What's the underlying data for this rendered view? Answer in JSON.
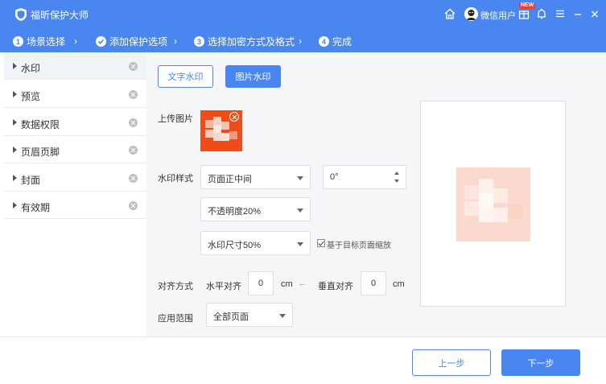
{
  "app": {
    "title": "福昕保护大师",
    "logo_icon": "shield-icon",
    "accent_color": "#4a86f0"
  },
  "titlebar": {
    "user_name": "微信用户",
    "new_badge": "NEW",
    "icons": [
      "home-icon",
      "user-avatar",
      "gift-icon",
      "bell-icon",
      "menu-icon",
      "minimize-icon",
      "close-icon"
    ]
  },
  "steps": [
    {
      "num": "1",
      "label": "场景选择",
      "state": "done"
    },
    {
      "num": "✓",
      "label": "添加保护选项",
      "state": "current"
    },
    {
      "num": "3",
      "label": "选择加密方式及格式",
      "state": "pending"
    },
    {
      "num": "4",
      "label": "完成",
      "state": "pending"
    }
  ],
  "sidebar": {
    "items": [
      {
        "label": "水印",
        "active": true
      },
      {
        "label": "预览",
        "active": false
      },
      {
        "label": "数据权限",
        "active": false
      },
      {
        "label": "页眉页脚",
        "active": false
      },
      {
        "label": "封面",
        "active": false
      },
      {
        "label": "有效期",
        "active": false
      }
    ]
  },
  "watermark": {
    "text_tab": "文字水印",
    "image_tab": "图片水印",
    "upload_label": "上传图片",
    "style_label": "水印样式",
    "position": "页面正中间",
    "rotation": "0°",
    "opacity": "不透明度20%",
    "size": "水印尺寸50%",
    "scale_checkbox": "基于目标页面缩放",
    "scale_checked": true,
    "align_label": "对齐方式",
    "h_align_label": "水平对齐",
    "h_value": "0",
    "h_unit": "cm",
    "v_align_label": "垂直对齐",
    "v_value": "0",
    "v_unit": "cm",
    "range_label": "应用范围",
    "range": "全部页面"
  },
  "footer": {
    "prev": "上一步",
    "next": "下一步"
  }
}
